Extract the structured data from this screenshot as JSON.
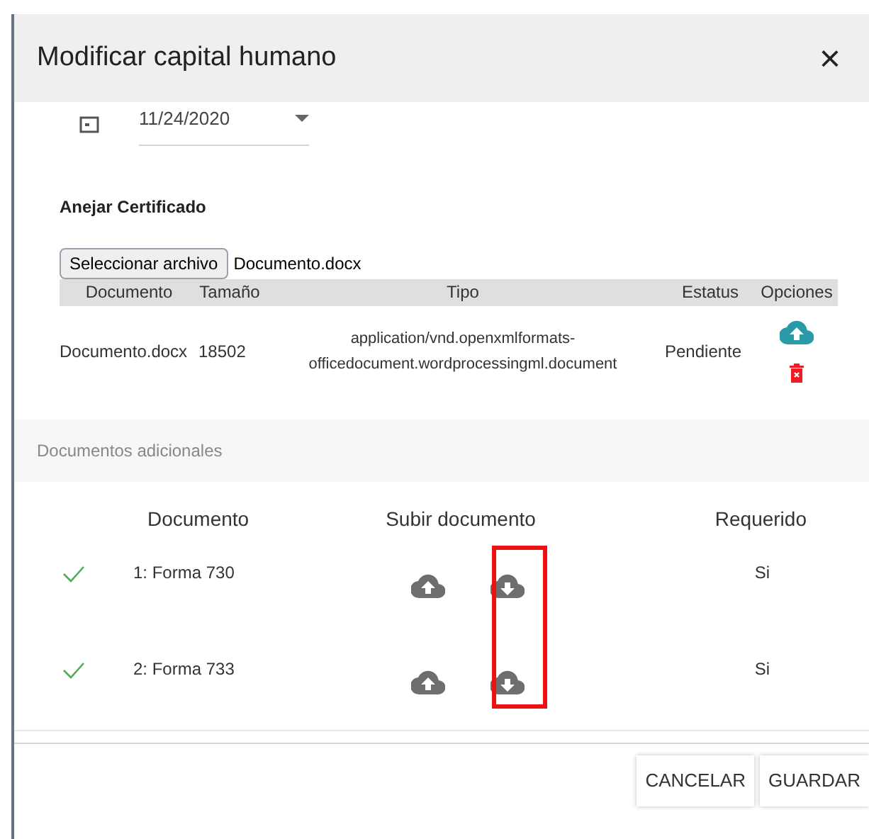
{
  "dialog": {
    "title": "Modificar capital humano",
    "close": "×"
  },
  "date": {
    "value": "11/24/2020"
  },
  "certificate": {
    "title": "Anejar Certificado",
    "file_button": "Seleccionar archivo",
    "file_name": "Documento.docx",
    "columns": [
      "Documento",
      "Tamaño",
      "Tipo",
      "Estatus",
      "Opciones"
    ],
    "rows": [
      {
        "document": "Documento.docx",
        "size": "18502",
        "type": "application/vnd.openxmlformats-officedocument.wordprocessingml.document",
        "status": "Pendiente"
      }
    ]
  },
  "additional": {
    "title": "Documentos adicionales",
    "columns": [
      "Documento",
      "Subir documento",
      "Requerido"
    ],
    "rows": [
      {
        "done": true,
        "document": "1: Forma 730",
        "required": "Si"
      },
      {
        "done": true,
        "document": "2: Forma 733",
        "required": "Si"
      }
    ]
  },
  "buttons": [
    "CANCELAR",
    "GUARDAR"
  ]
}
